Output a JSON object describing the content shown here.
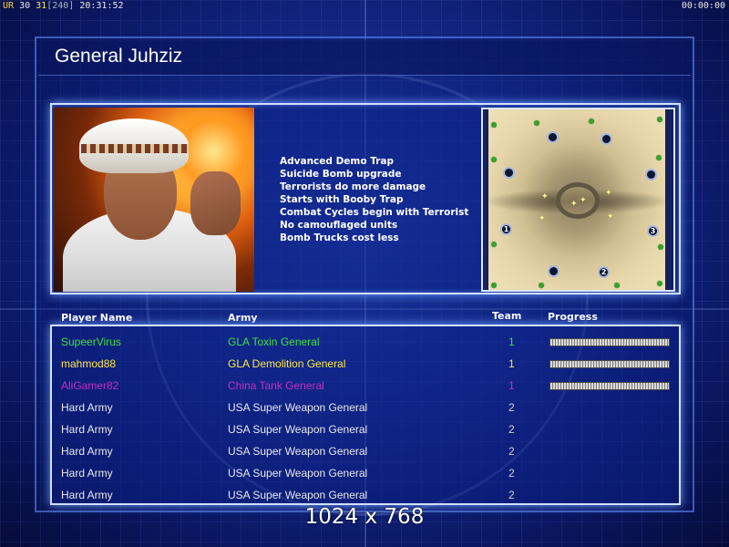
{
  "status_bar": {
    "ur": "UR",
    "num1": "30",
    "num2": "31",
    "num3": "[240]",
    "clock": "20:31:52",
    "timer": "00:00:00"
  },
  "title": "General Juhziz",
  "perks": [
    "Advanced Demo Trap",
    "Suicide Bomb upgrade",
    "Terrorists do more damage",
    "Starts with Booby Trap",
    "Combat Cycles begin with Terrorist",
    "No camouflaged units",
    "Bomb Trucks cost less"
  ],
  "minimap": {
    "start_labels": [
      "1",
      "2",
      "3"
    ]
  },
  "table": {
    "headers": {
      "name": "Player Name",
      "army": "Army",
      "team": "Team",
      "progress": "Progress"
    },
    "rows": [
      {
        "name": "SupeerVirus",
        "army": "GLA Toxin General",
        "team": "1",
        "color": "#3fe03a",
        "team_color": "#3fe03a",
        "progress": 1.0
      },
      {
        "name": "mahmod88",
        "army": "GLA Demolition General",
        "team": "1",
        "color": "#ffe640",
        "team_color": "#ffe640",
        "progress": 1.0
      },
      {
        "name": "AliGamer82",
        "army": "China Tank General",
        "team": "1",
        "color": "#c030c0",
        "team_color": "#c030c0",
        "progress": 1.0
      },
      {
        "name": "Hard Army",
        "army": "USA Super Weapon General",
        "team": "2",
        "color": "#e8e8e8",
        "team_color": "#d0d0d0",
        "progress": null
      },
      {
        "name": "Hard Army",
        "army": "USA Super Weapon General",
        "team": "2",
        "color": "#e8e8e8",
        "team_color": "#d0d0d0",
        "progress": null
      },
      {
        "name": "Hard Army",
        "army": "USA Super Weapon General",
        "team": "2",
        "color": "#e8e8e8",
        "team_color": "#d0d0d0",
        "progress": null
      },
      {
        "name": "Hard Army",
        "army": "USA Super Weapon General",
        "team": "2",
        "color": "#e8e8e8",
        "team_color": "#d0d0d0",
        "progress": null
      },
      {
        "name": "Hard Army",
        "army": "USA Super Weapon General",
        "team": "2",
        "color": "#e8e8e8",
        "team_color": "#d0d0d0",
        "progress": null
      }
    ]
  },
  "resolution": "1024 x 768"
}
